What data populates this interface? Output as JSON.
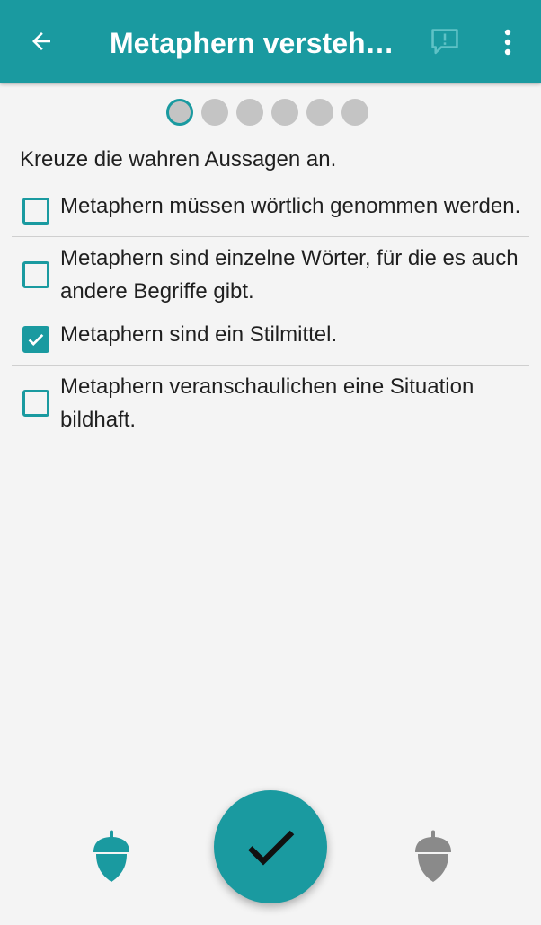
{
  "appbar": {
    "title": "Metaphern verstehe...",
    "back_icon": "arrow-left-icon",
    "feedback_icon": "feedback-icon",
    "menu_icon": "more-vertical-icon"
  },
  "progress": {
    "total": 6,
    "current": 1
  },
  "instruction": "Kreuze die wahren Aussagen an.",
  "options": [
    {
      "label": "Metaphern müssen wörtlich genommen werden.",
      "checked": false
    },
    {
      "label": "Metaphern sind einzelne Wörter, für die es auch andere Begriffe gibt.",
      "checked": false
    },
    {
      "label": "Metaphern sind ein Stilmittel.",
      "checked": true
    },
    {
      "label": "Metaphern veranschaulichen eine Situation bildhaft.",
      "checked": false
    }
  ],
  "bottom": {
    "left_icon": "acorn-icon",
    "submit_icon": "checkmark-icon",
    "right_icon": "acorn-icon"
  },
  "colors": {
    "accent": "#1a9aa0",
    "acorn_inactive": "#8a8a8a",
    "background": "#f4f4f4"
  }
}
